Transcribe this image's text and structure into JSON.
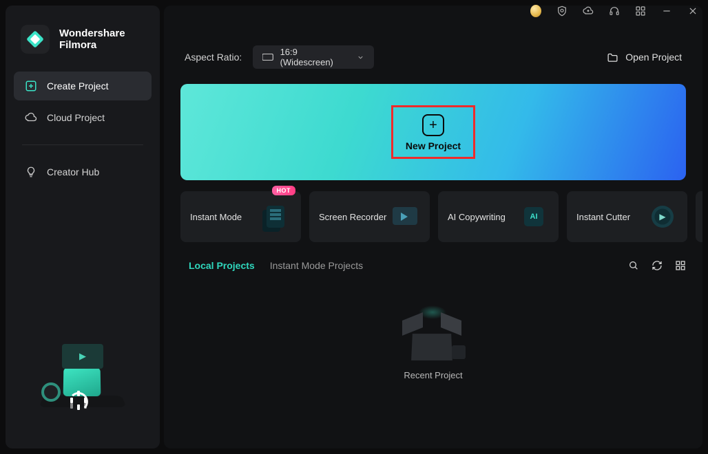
{
  "brand": {
    "top": "Wondershare",
    "bottom": "Filmora"
  },
  "sidebar": {
    "items": [
      {
        "label": "Create Project",
        "icon": "plus-square-icon",
        "active": true
      },
      {
        "label": "Cloud Project",
        "icon": "cloud-icon",
        "active": false
      },
      {
        "label": "Creator Hub",
        "icon": "bulb-icon",
        "active": false
      }
    ]
  },
  "titlebar": {
    "icons": [
      "coin-icon",
      "shield-icon",
      "cloud-sync-icon",
      "headset-icon",
      "apps-icon",
      "minimize-icon",
      "close-icon"
    ]
  },
  "aspect": {
    "label": "Aspect Ratio:",
    "value": "16:9 (Widescreen)"
  },
  "open_project_label": "Open Project",
  "hero": {
    "cta": "New Project"
  },
  "cards": [
    {
      "label": "Instant Mode",
      "badge": "HOT",
      "icon": "instant"
    },
    {
      "label": "Screen Recorder",
      "badge": null,
      "icon": "screen"
    },
    {
      "label": "AI Copywriting",
      "badge": null,
      "icon": "ai"
    },
    {
      "label": "Instant Cutter",
      "badge": null,
      "icon": "cutter"
    }
  ],
  "tabs": {
    "items": [
      {
        "label": "Local Projects",
        "active": true
      },
      {
        "label": "Instant Mode Projects",
        "active": false
      }
    ]
  },
  "empty": {
    "label": "Recent Project"
  }
}
